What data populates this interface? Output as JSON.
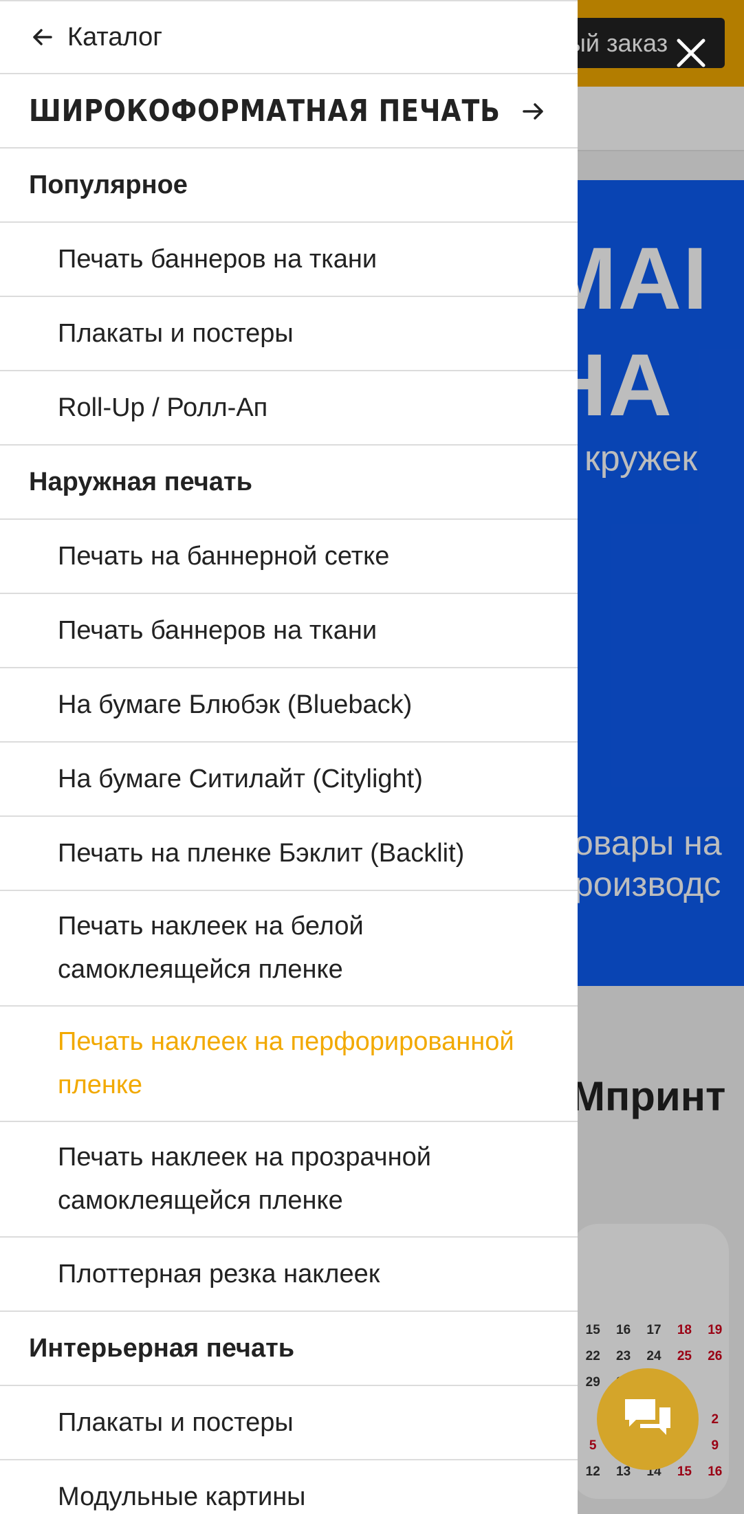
{
  "colors": {
    "accent": "#f2a900",
    "banner_blue": "#0d5cf2",
    "chat_button": "#d4a52a",
    "text_primary": "#222222",
    "divider": "#dcdcdc"
  },
  "background_page": {
    "order_button_label": "ый заказ",
    "banner_line_1": "МАІ",
    "banner_line_2": "НА",
    "banner_subtitle": "кружек",
    "banner_text_1": "овары на",
    "banner_text_2": "роизводс",
    "section_heading": "Мпринт",
    "calendar_numbers": [
      {
        "n": "15",
        "red": false
      },
      {
        "n": "16",
        "red": false
      },
      {
        "n": "17",
        "red": false
      },
      {
        "n": "18",
        "red": true
      },
      {
        "n": "19",
        "red": true
      },
      {
        "n": "22",
        "red": false
      },
      {
        "n": "23",
        "red": false
      },
      {
        "n": "24",
        "red": false
      },
      {
        "n": "25",
        "red": true
      },
      {
        "n": "26",
        "red": true
      },
      {
        "n": "29",
        "red": false
      },
      {
        "n": "30",
        "red": false
      },
      {
        "n": "",
        "red": false
      },
      {
        "n": "",
        "red": false
      },
      {
        "n": "",
        "red": false
      },
      {
        "n": "",
        "red": false
      },
      {
        "n": "",
        "red": false
      },
      {
        "n": "",
        "red": false
      },
      {
        "n": "",
        "red": false
      },
      {
        "n": "",
        "red": false
      },
      {
        "n": "",
        "red": false
      },
      {
        "n": "",
        "red": false
      },
      {
        "n": "",
        "red": false
      },
      {
        "n": "",
        "red": false
      },
      {
        "n": "2",
        "red": true
      },
      {
        "n": "5",
        "red": true
      },
      {
        "n": "",
        "red": false
      },
      {
        "n": "",
        "red": false
      },
      {
        "n": "",
        "red": false
      },
      {
        "n": "9",
        "red": true
      },
      {
        "n": "12",
        "red": false
      },
      {
        "n": "13",
        "red": false
      },
      {
        "n": "14",
        "red": false
      },
      {
        "n": "15",
        "red": true
      },
      {
        "n": "16",
        "red": true
      }
    ]
  },
  "drawer": {
    "back_label": "Каталог",
    "section_title": "Широкоформатная печать",
    "groups": [
      {
        "title": "Популярное",
        "items": [
          {
            "label": "Печать баннеров на ткани",
            "active": false
          },
          {
            "label": "Плакаты и постеры",
            "active": false
          },
          {
            "label": "Roll-Up / Ролл-Ап",
            "active": false
          }
        ]
      },
      {
        "title": "Наружная печать",
        "items": [
          {
            "label": "Печать на баннерной сетке",
            "active": false
          },
          {
            "label": "Печать баннеров на ткани",
            "active": false
          },
          {
            "label": "На бумаге Блюбэк (Blueback)",
            "active": false
          },
          {
            "label": "На бумаге Ситилайт (Citylight)",
            "active": false
          },
          {
            "label": "Печать на пленке Бэклит (Backlit)",
            "active": false
          },
          {
            "label": "Печать наклеек на белой самоклеящейся пленке",
            "active": false
          },
          {
            "label": "Печать наклеек на перфорированной пленке",
            "active": true
          },
          {
            "label": "Печать наклеек на прозрачной самоклеящейся пленке",
            "active": false
          },
          {
            "label": "Плоттерная резка наклеек",
            "active": false
          }
        ]
      },
      {
        "title": "Интерьерная печать",
        "items": [
          {
            "label": "Плакаты и постеры",
            "active": false
          },
          {
            "label": "Модульные картины",
            "active": false
          }
        ]
      }
    ]
  }
}
